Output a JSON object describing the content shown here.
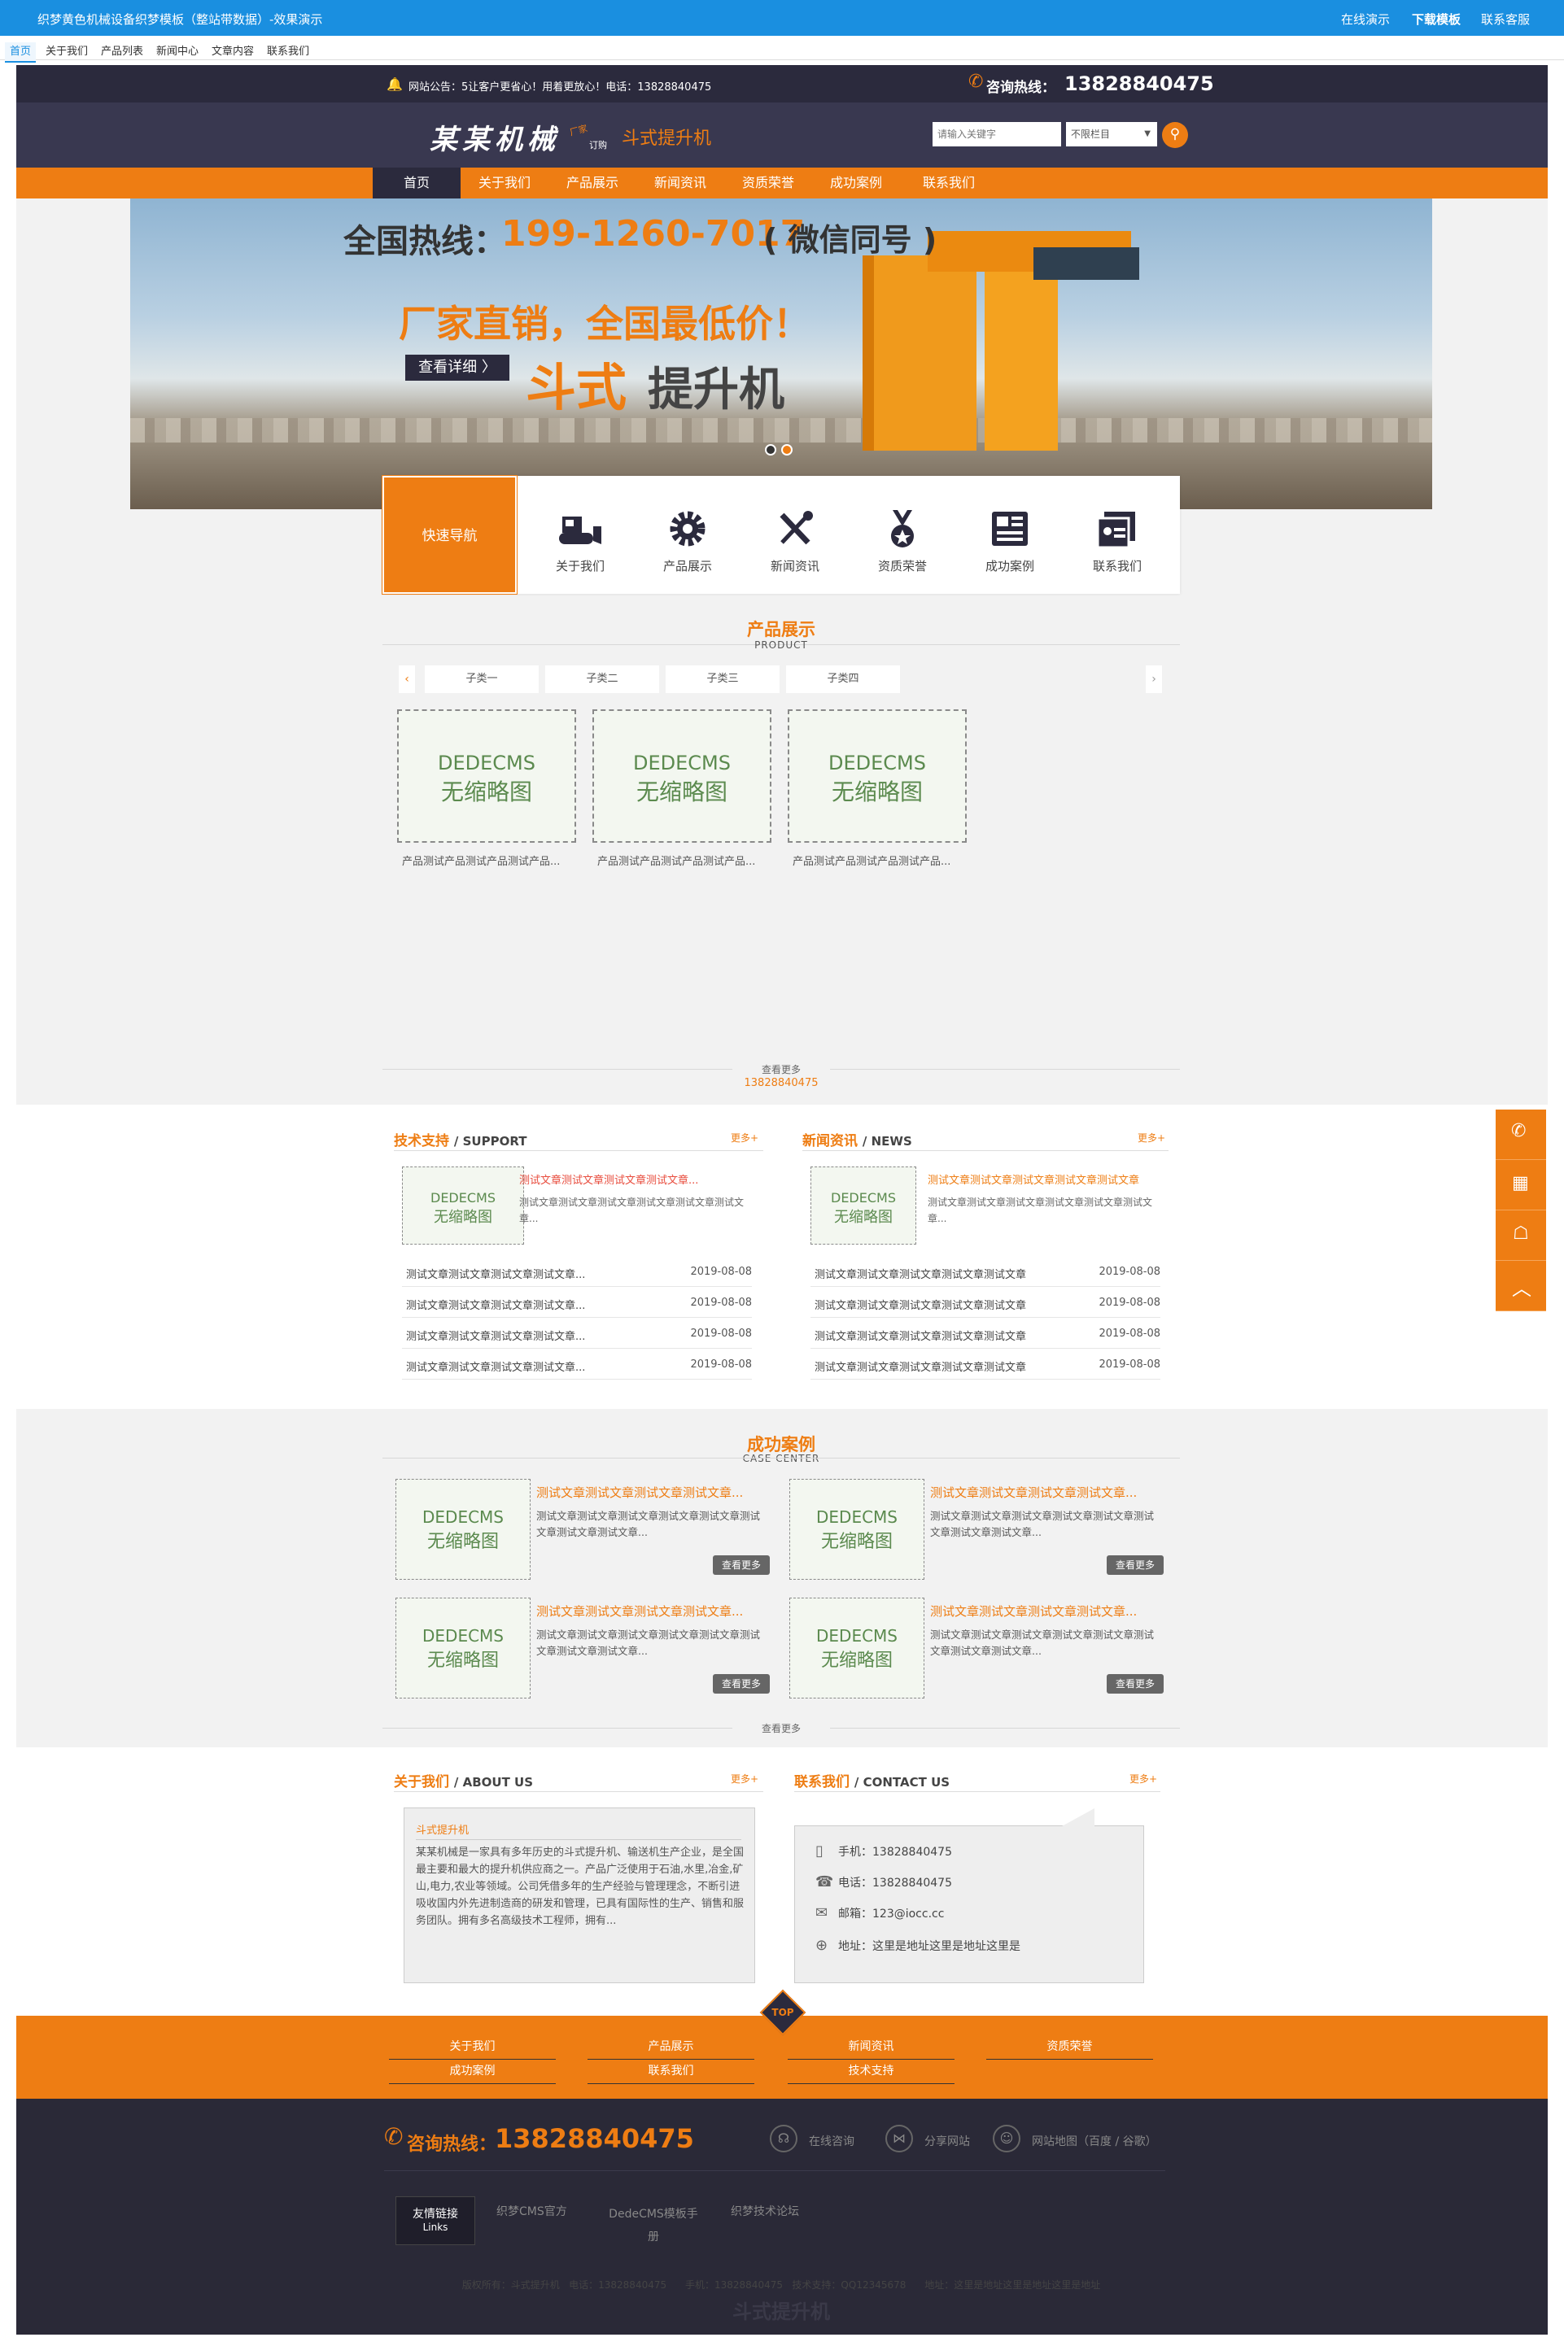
{
  "demo_bar": {
    "title": "织梦黄色机械设备织梦模板（整站带数据）-效果演示",
    "links": [
      "在线演示",
      "下载模板",
      "联系客服"
    ]
  },
  "demo_tabs": [
    "首页",
    "关于我们",
    "产品列表",
    "新闻中心",
    "文章内容",
    "联系我们"
  ],
  "topbar": {
    "notice": "网站公告：5让客户更省心！用着更放心！电话：13828840475",
    "hotline_label": "咨询热线：",
    "hotline": "13828840475"
  },
  "header": {
    "logo": "某某机械",
    "logo_tag_top": "厂家",
    "logo_tag_bottom": "订购",
    "logo_product": "斗式提升机",
    "search_placeholder": "请输入关键字",
    "select_value": "不限栏目"
  },
  "nav": [
    "首页",
    "关于我们",
    "产品展示",
    "新闻资讯",
    "资质荣誉",
    "成功案例",
    "联系我们"
  ],
  "banner": {
    "hotline_prefix": "全国热线：",
    "hotline": "199-1260-7017",
    "hotline_suffix": "( 微信同号 )",
    "slogan": "厂家直销，全国最低价！",
    "detail_btn": "查看详细 〉",
    "product_a": "斗式",
    "product_b": "提升机"
  },
  "quick_nav": {
    "title": "快速导航",
    "items": [
      "关于我们",
      "产品展示",
      "新闻资讯",
      "资质荣誉",
      "成功案例",
      "联系我们"
    ]
  },
  "products": {
    "title": "产品展示",
    "sub": "PRODUCT",
    "tabs": [
      "子类一",
      "子类二",
      "子类三",
      "子类四"
    ],
    "thumb_top": "DEDECMS",
    "thumb_bottom": "无缩略图",
    "items": [
      "产品测试产品测试产品测试产品...",
      "产品测试产品测试产品测试产品...",
      "产品测试产品测试产品测试产品..."
    ],
    "more": "查看更多",
    "phone": "13828840475"
  },
  "support": {
    "title": "技术支持",
    "sub": "/ SUPPORT",
    "more": "更多+",
    "feature_title": "测试文章测试文章测试文章测试文章...",
    "feature_desc": "测试文章测试文章测试文章测试文章测试文章测试文章...",
    "rows": [
      {
        "t": "测试文章测试文章测试文章测试文章...",
        "d": "2019-08-08"
      },
      {
        "t": "测试文章测试文章测试文章测试文章...",
        "d": "2019-08-08"
      },
      {
        "t": "测试文章测试文章测试文章测试文章...",
        "d": "2019-08-08"
      },
      {
        "t": "测试文章测试文章测试文章测试文章...",
        "d": "2019-08-08"
      }
    ]
  },
  "news": {
    "title": "新闻资讯",
    "sub": "/ NEWS",
    "more": "更多+",
    "feature_title": "测试文章测试文章测试文章测试文章测试文章",
    "feature_desc": "测试文章测试文章测试文章测试文章测试文章测试文章...",
    "rows": [
      {
        "t": "测试文章测试文章测试文章测试文章测试文章",
        "d": "2019-08-08"
      },
      {
        "t": "测试文章测试文章测试文章测试文章测试文章",
        "d": "2019-08-08"
      },
      {
        "t": "测试文章测试文章测试文章测试文章测试文章",
        "d": "2019-08-08"
      },
      {
        "t": "测试文章测试文章测试文章测试文章测试文章",
        "d": "2019-08-08"
      }
    ]
  },
  "cases": {
    "title": "成功案例",
    "sub": "CASE CENTER",
    "item_title": "测试文章测试文章测试文章测试文章...",
    "item_desc": "测试文章测试文章测试文章测试文章测试文章测试文章测试文章测试文章...",
    "btn": "查看更多",
    "more": "查看更多"
  },
  "about": {
    "title": "关于我们",
    "sub": "/ ABOUT US",
    "more": "更多+",
    "box_title": "斗式提升机",
    "text": "某某机械是一家具有多年历史的斗式提升机、输送机生产企业，是全国最主要和最大的提升机供应商之一。产品广泛使用于石油,水里,冶金,矿山,电力,农业等领域。公司凭借多年的生产经验与管理理念，不断引进吸收国内外先进制造商的研发和管理，已具有国际性的生产、销售和服务团队。拥有多名高级技术工程师，拥有..."
  },
  "contact": {
    "title": "联系我们",
    "sub": "/ CONTACT US",
    "more": "更多+",
    "mobile": "手机：13828840475",
    "tel": "电话：13828840475",
    "email": "邮箱：123@iocc.cc",
    "addr": "地址：这里是地址这里是地址这里是"
  },
  "footer": {
    "top": "TOP",
    "links_row1": [
      "关于我们",
      "产品展示",
      "新闻资讯",
      "资质荣誉"
    ],
    "links_row2": [
      "成功案例",
      "联系我们",
      "技术支持"
    ],
    "hotline_label": "咨询热线：",
    "hotline": "13828840475",
    "actions": [
      "在线咨询",
      "分享网站",
      "网站地图（百度 / 谷歌）"
    ],
    "friend_title": "友情链接",
    "friend_sub": "Links",
    "friend_links": [
      "织梦CMS官方",
      "DedeCMS模板手册",
      "织梦技术论坛"
    ],
    "copyright": "版权所有：斗式提升机   电话：13828840475      手机：13828840475   技术支持：QQ12345678      地址：这里是地址这里是地址这里是地址",
    "bottom_logo": "斗式提升机"
  },
  "side_icons": [
    "phone-icon",
    "qrcode-icon",
    "qq-icon",
    "back-to-top-icon"
  ],
  "colors": {
    "accent": "#ee7d13",
    "dark": "#2b2a3d",
    "header": "#393850",
    "demo_bar": "#1a8fe0"
  }
}
